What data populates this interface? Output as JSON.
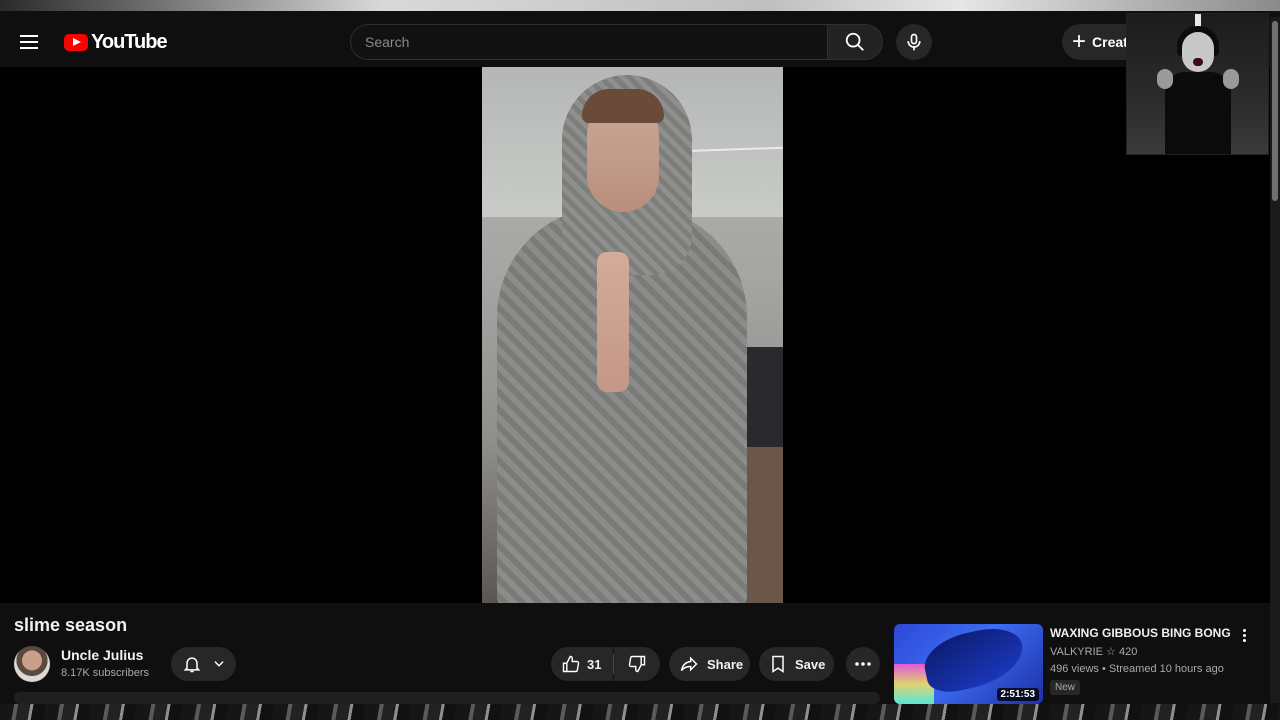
{
  "masthead": {
    "logo_text": "YouTube",
    "search_placeholder": "Search",
    "create_label": "Create"
  },
  "video": {
    "title": "slime season",
    "channel": {
      "name": "Uncle Julius",
      "subscribers": "8.17K subscribers"
    },
    "actions": {
      "like_count": "31",
      "share_label": "Share",
      "save_label": "Save"
    }
  },
  "recommendation": {
    "title": "WAXING GIBBOUS BING BONG",
    "channel": "VALKYRIE ☆ 420",
    "meta": "496 views • Streamed 10 hours ago",
    "badge": "New",
    "duration": "2:51:53",
    "thumbnail_colors": [
      "#2e47d8",
      "#0b1a6b"
    ]
  },
  "icons": [
    "menu-icon",
    "youtube-logo-icon",
    "search-icon",
    "mic-icon",
    "plus-icon",
    "bell-icon",
    "chevron-down-icon",
    "thumbs-up-icon",
    "thumbs-down-icon",
    "share-icon",
    "save-icon",
    "more-icon",
    "more-vert-icon"
  ],
  "colors": {
    "background": "#0f0f0f",
    "brand_red": "#ff0000",
    "button_bg": "#272727"
  }
}
